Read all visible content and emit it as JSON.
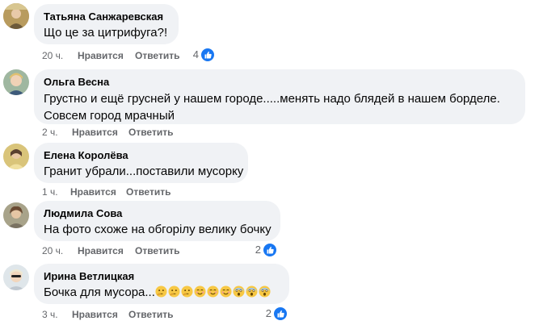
{
  "colors": {
    "bubble": "#f0f2f5",
    "meta": "#65676b",
    "like": "#1877f2"
  },
  "comments": [
    {
      "author": "Татьяна Санжаревская",
      "lines": [
        "Що це за цитрифуга?!"
      ],
      "time": "20 ч.",
      "like_label": "Нравится",
      "reply_label": "Ответить",
      "reactions": "4"
    },
    {
      "author": "Ольга Весна",
      "lines": [
        "Грустно и ещё грусней у нашем городе.....менять надо блядей в нашем борделе.",
        "Совсем город мрачный"
      ],
      "time": "2 ч.",
      "like_label": "Нравится",
      "reply_label": "Ответить",
      "reactions": ""
    },
    {
      "author": "Елена Королёва",
      "lines": [
        "Гранит убрали...поставили мусорку"
      ],
      "time": "1 ч.",
      "like_label": "Нравится",
      "reply_label": "Ответить",
      "reactions": ""
    },
    {
      "author": "Людмила Сова",
      "lines": [
        "На фото схоже на обгорілу велику бочку"
      ],
      "time": "20 ч.",
      "like_label": "Нравится",
      "reply_label": "Ответить",
      "reactions": "2"
    },
    {
      "author": "Ирина Ветлицкая",
      "lines": [
        "Бочка для мусора..."
      ],
      "emojis": [
        "thinking-face-icon",
        "thinking-face-icon",
        "thinking-face-icon",
        "smiling-face-icon",
        "smiling-face-icon",
        "smiling-face-icon",
        "screaming-face-icon",
        "screaming-face-icon",
        "screaming-face-icon"
      ],
      "time": "3 ч.",
      "like_label": "Нравится",
      "reply_label": "Ответить",
      "reactions": "2"
    }
  ]
}
